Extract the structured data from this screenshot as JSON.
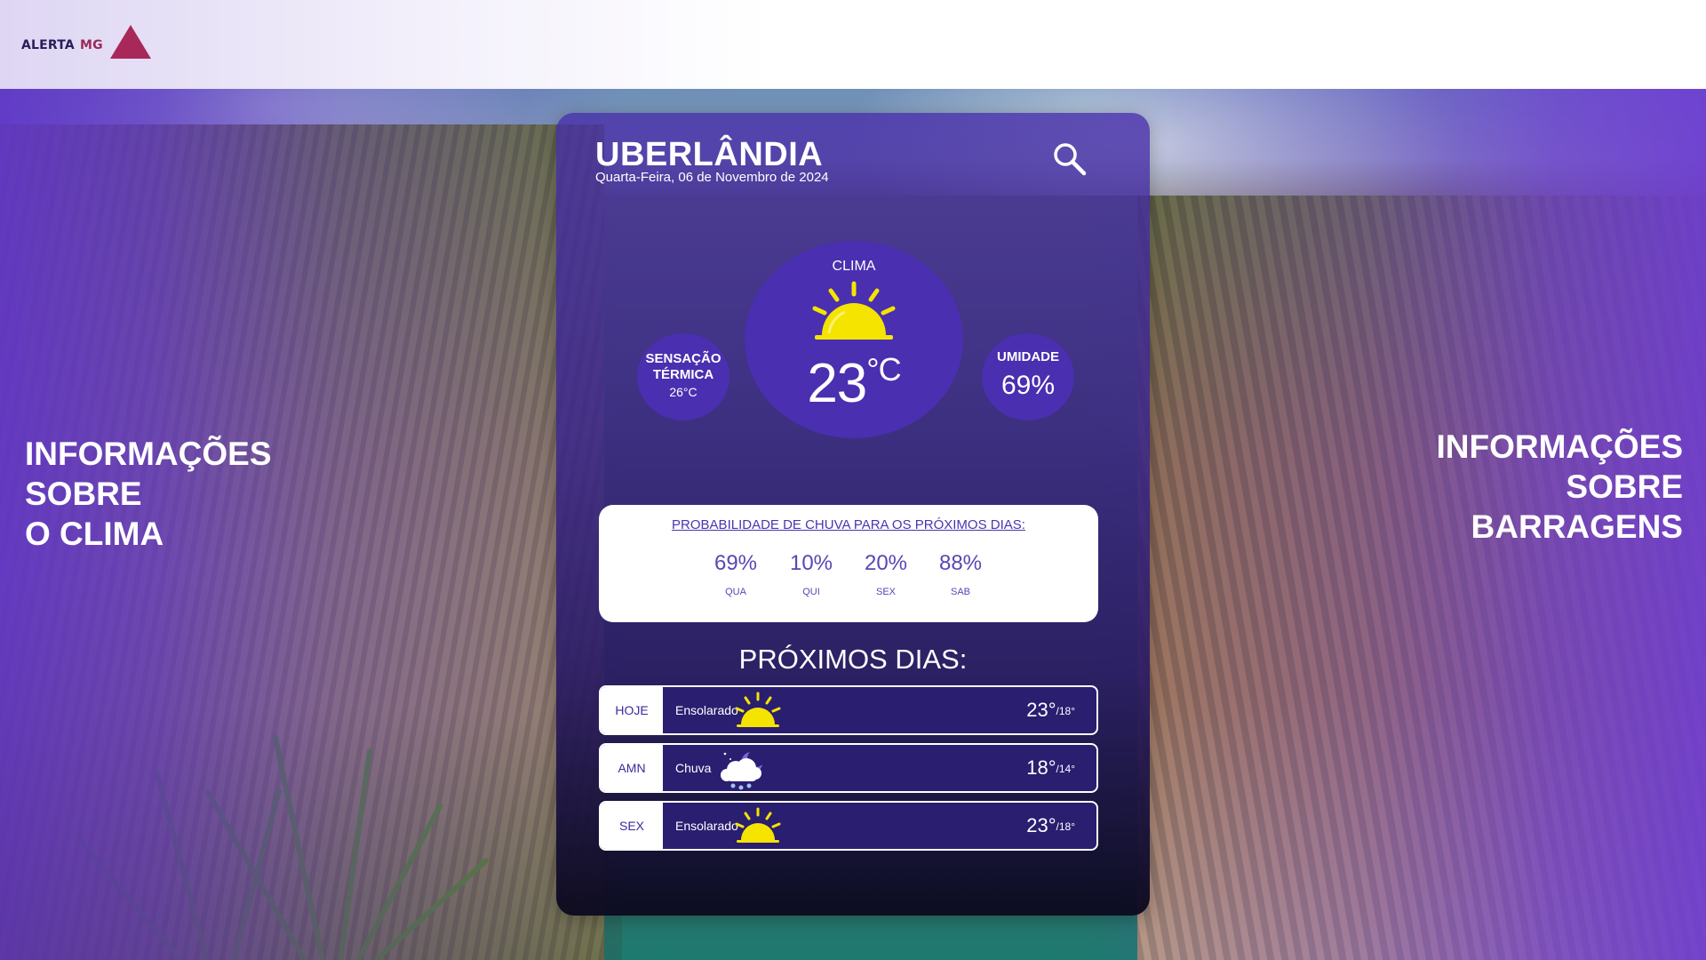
{
  "header": {
    "logo_part1": "ALERTA",
    "logo_part2": "MG",
    "logo_icon": "triangle-icon"
  },
  "side": {
    "left_title": [
      "INFORMAÇÕES",
      "SOBRE",
      "O CLIMA"
    ],
    "right_title": [
      "INFORMAÇÕES",
      "SOBRE",
      "BARRAGENS"
    ]
  },
  "weather": {
    "city": "UBERLÂNDIA",
    "date": "Quarta-Feira, 06 de Novembro de 2024",
    "search_icon": "search-icon",
    "current": {
      "label": "CLIMA",
      "icon": "sun-icon",
      "temp": "23",
      "unit": "°C"
    },
    "feels_like": {
      "label_line1": "SENSAÇÃO",
      "label_line2": "TÉRMICA",
      "value": "26°C"
    },
    "humidity": {
      "label": "UMIDADE",
      "value": "69%"
    },
    "rain_probability": {
      "title": "PROBABILIDADE DE CHUVA PARA OS PRÓXIMOS DIAS:",
      "days": [
        {
          "percent": "69%",
          "day": "QUA"
        },
        {
          "percent": "10%",
          "day": "QUI"
        },
        {
          "percent": "20%",
          "day": "SEX"
        },
        {
          "percent": "88%",
          "day": "SAB"
        }
      ]
    },
    "next_days_title": "PRÓXIMOS DIAS:",
    "forecast": [
      {
        "day": "HOJE",
        "condition": "Ensolarado",
        "icon": "sun-icon",
        "high": "23°",
        "low": "/18°"
      },
      {
        "day": "AMN",
        "condition": "Chuva",
        "icon": "rain-cloud-moon-icon",
        "high": "18°",
        "low": "/14°"
      },
      {
        "day": "SEX",
        "condition": "Ensolarado",
        "icon": "sun-icon",
        "high": "23°",
        "low": "/18°"
      }
    ]
  },
  "colors": {
    "brand_purple": "#4a2fb0",
    "logo_accent": "#a8285a",
    "sun_yellow": "#f5e400"
  }
}
